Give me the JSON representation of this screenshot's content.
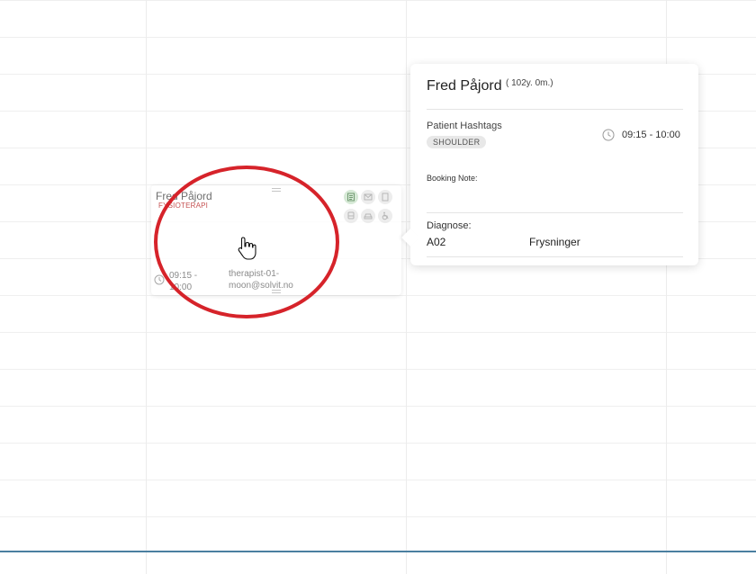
{
  "appointment": {
    "patient_name": "Fred Påjord",
    "category": "FYSIOTERAPI",
    "time": "09:15 - 10:00",
    "therapist": "therapist-01-moon@solvit.no",
    "icons": [
      "note-icon",
      "mail-icon",
      "document-icon",
      "transport-icon",
      "car-icon",
      "wheelchair-icon"
    ]
  },
  "popup": {
    "name": "Fred Påjord",
    "age": "( 102y. 0m.)",
    "hashtags_label": "Patient Hashtags",
    "tag": "SHOULDER",
    "time": "09:15 - 10:00",
    "booking_note_label": "Booking Note:",
    "diagnose_label": "Diagnose:",
    "diagnose_code": "A02",
    "diagnose_text": "Frysninger"
  },
  "colors": {
    "annotation_circle": "#d6232a",
    "accent_line": "#4a7fa0",
    "category": "#b33333"
  }
}
